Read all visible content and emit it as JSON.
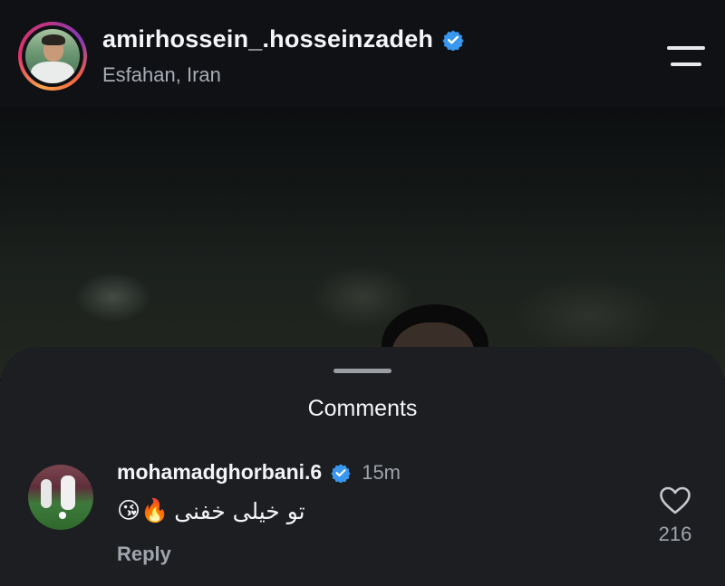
{
  "header": {
    "username": "amirhossein_.hosseinzadeh",
    "location": "Esfahan, Iran",
    "verified": true,
    "menu_icon": "hamburger-menu-icon"
  },
  "comments_sheet": {
    "title": "Comments",
    "comments": [
      {
        "username": "mohamadghorbani.6",
        "verified": true,
        "time": "15m",
        "emojis": "😘🔥",
        "text": "تو خیلی خفنی",
        "reply_label": "Reply",
        "like_count": "216",
        "like_icon": "heart-outline-icon"
      }
    ]
  },
  "colors": {
    "verified_badge": "#3897f0",
    "sheet_bg": "#1d1e21",
    "header_bg": "#0f1114"
  }
}
